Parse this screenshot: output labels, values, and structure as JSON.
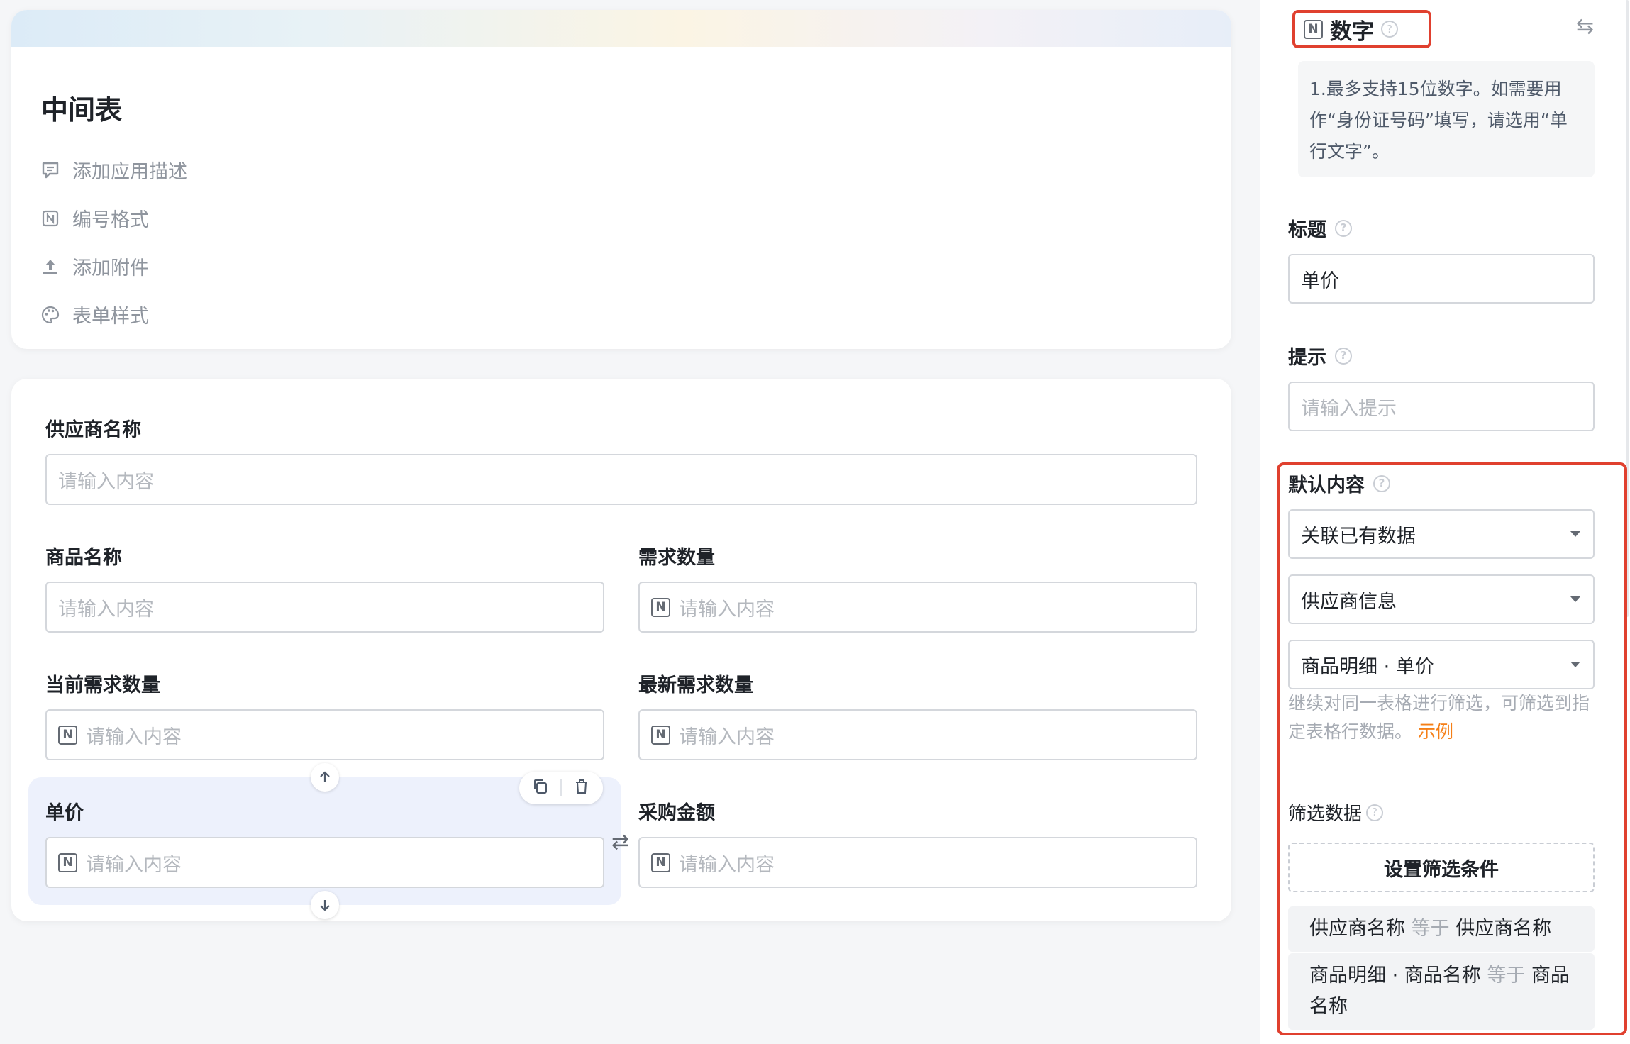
{
  "header_card": {
    "title": "中间表",
    "meta": [
      {
        "label": "添加应用描述",
        "icon": "comment-icon"
      },
      {
        "label": "编号格式",
        "icon": "number-icon"
      },
      {
        "label": "添加附件",
        "icon": "upload-icon"
      },
      {
        "label": "表单样式",
        "icon": "palette-icon"
      }
    ]
  },
  "form": {
    "fields": [
      {
        "label": "供应商名称",
        "placeholder": "请输入内容",
        "number": false
      },
      {
        "label": "商品名称",
        "placeholder": "请输入内容",
        "number": false
      },
      {
        "label": "需求数量",
        "placeholder": "请输入内容",
        "number": true
      },
      {
        "label": "当前需求数量",
        "placeholder": "请输入内容",
        "number": true
      },
      {
        "label": "最新需求数量",
        "placeholder": "请输入内容",
        "number": true
      },
      {
        "label": "单价",
        "placeholder": "请输入内容",
        "number": true,
        "selected": true
      },
      {
        "label": "采购金额",
        "placeholder": "请输入内容",
        "number": true
      }
    ]
  },
  "panel": {
    "type_icon": "N",
    "type_title": "数字",
    "note": "1.最多支持15位数字。如需要用作“身份证号码”填写，请选用“单行文字”。",
    "title_label": "标题",
    "title_value": "单价",
    "hint_label": "提示",
    "hint_placeholder": "请输入提示",
    "default_label": "默认内容",
    "default_mode": "关联已有数据",
    "default_source": "供应商信息",
    "default_field": "商品明细 · 单价",
    "default_hint": "继续对同一表格进行筛选，可筛选到指定表格行数据。",
    "example_link": "示例",
    "filter_label": "筛选数据",
    "filter_button": "设置筛选条件",
    "conditions": [
      {
        "left": "供应商名称",
        "op": "等于",
        "right": "供应商名称"
      },
      {
        "left": "商品明细 · 商品名称",
        "op": "等于",
        "right": "商品名称"
      }
    ]
  },
  "colors": {
    "accent_red": "#e0402f",
    "link_orange": "#f57f17",
    "selected_bg": "#edf1fc"
  }
}
